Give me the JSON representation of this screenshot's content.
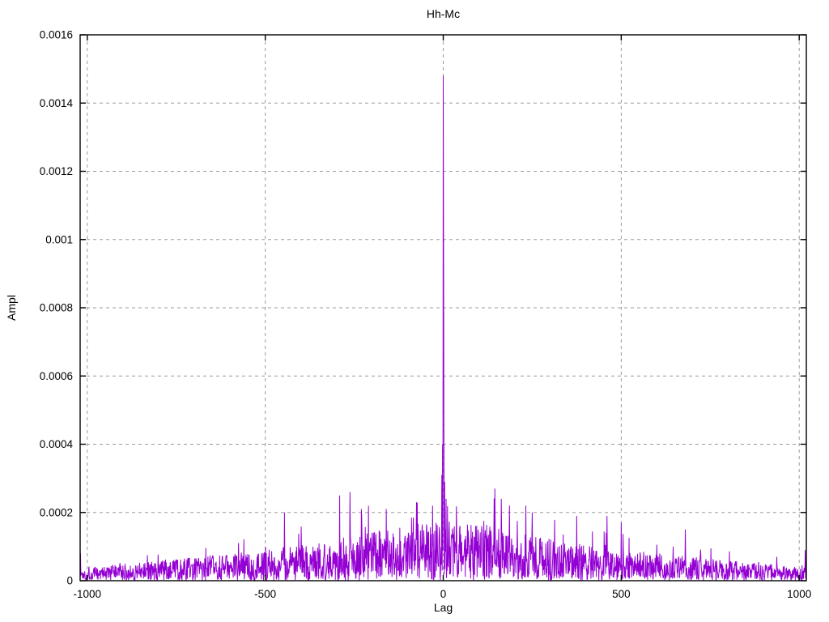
{
  "chart_data": {
    "type": "line",
    "title": "Hh-Mc",
    "xlabel": "Lag",
    "ylabel": "Ampl",
    "xlim": [
      -1020,
      1020
    ],
    "ylim": [
      0,
      0.0016
    ],
    "x_ticks": [
      {
        "value": -1000,
        "label": "-1000"
      },
      {
        "value": -500,
        "label": "-500"
      },
      {
        "value": 0,
        "label": "0"
      },
      {
        "value": 500,
        "label": "500"
      },
      {
        "value": 1000,
        "label": "1000"
      }
    ],
    "y_ticks": [
      {
        "value": 0,
        "label": "0"
      },
      {
        "value": 0.0002,
        "label": "0.0002"
      },
      {
        "value": 0.0004,
        "label": "0.0004"
      },
      {
        "value": 0.0006,
        "label": "0.0006"
      },
      {
        "value": 0.0008,
        "label": "0.0008"
      },
      {
        "value": 0.001,
        "label": "0.001"
      },
      {
        "value": 0.0012,
        "label": "0.0012"
      },
      {
        "value": 0.0014,
        "label": "0.0014"
      },
      {
        "value": 0.0016,
        "label": "0.0016"
      }
    ],
    "grid": {
      "visible": true,
      "color": "#9a9a9a",
      "dash": "4 4"
    },
    "legend": "none",
    "line_color": "#9400D3",
    "border_color": "#000000",
    "background": "#ffffff",
    "peak": {
      "lag": 0,
      "ampl": 0.00148
    },
    "notable_spikes": [
      {
        "lag": 1,
        "ampl": 0.00092
      },
      {
        "lag": -2,
        "ampl": 0.0004
      },
      {
        "lag": 2,
        "ampl": 0.00038
      },
      {
        "lag": -4,
        "ampl": 0.00031
      },
      {
        "lag": 4,
        "ampl": 0.00029
      },
      {
        "lag": -446,
        "ampl": 0.0002
      },
      {
        "lag": -291,
        "ampl": 0.00025
      },
      {
        "lag": -262,
        "ampl": 0.00026
      },
      {
        "lag": -230,
        "ampl": 0.00021
      },
      {
        "lag": -210,
        "ampl": 0.00022
      },
      {
        "lag": -160,
        "ampl": 0.00021
      },
      {
        "lag": -75,
        "ampl": 0.00023
      },
      {
        "lag": -30,
        "ampl": 0.00022
      },
      {
        "lag": 8,
        "ampl": 0.00024
      },
      {
        "lag": 145,
        "ampl": 0.00027
      },
      {
        "lag": 163,
        "ampl": 0.00024
      },
      {
        "lag": 232,
        "ampl": 0.00022
      },
      {
        "lag": 250,
        "ampl": 0.0002
      },
      {
        "lag": 375,
        "ampl": 0.00019
      },
      {
        "lag": 460,
        "ampl": 0.00019
      },
      {
        "lag": 500,
        "ampl": 0.00017
      },
      {
        "lag": 680,
        "ampl": 0.00015
      },
      {
        "lag": -1019,
        "ampl": 8e-05
      },
      {
        "lag": 1017,
        "ampl": 9e-05
      }
    ],
    "noise_model": {
      "seed": 1337,
      "lag_step": 1,
      "base": 2.5e-05,
      "tri_amp": 0.000115,
      "tri_extent": 1150,
      "gauss_amp": 4e-05,
      "gauss_sigma": 280,
      "power": 1.1,
      "spike_chance": 0.05,
      "spike_gain": 1.55
    }
  }
}
